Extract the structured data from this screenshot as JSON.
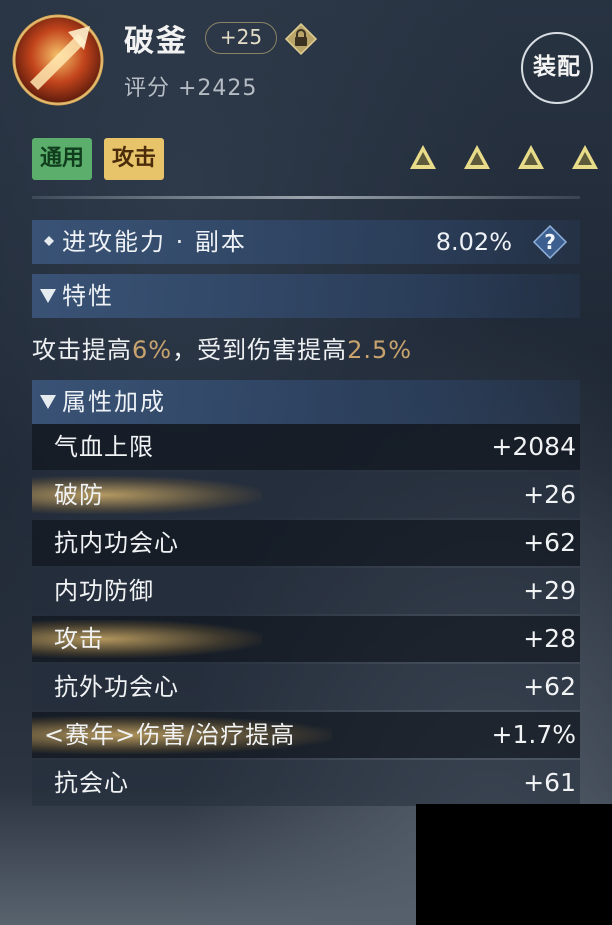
{
  "item": {
    "name": "破釜",
    "refine": "+25",
    "score": "评分 +2425",
    "equip_button": "装配"
  },
  "tags": [
    "通用",
    "攻击"
  ],
  "rank_markers": 4,
  "colors": {
    "accent_gold": "#c9a36e",
    "tag_green": "#5cae6d",
    "tag_orange": "#e7c36a"
  },
  "attack_stat": {
    "label": "进攻能力 · 副本",
    "value": "8.02%"
  },
  "traits": {
    "header": "特性",
    "text_a": "攻击提高",
    "val_a": "6%",
    "text_b": "，受到伤害提高",
    "val_b": "2.5%"
  },
  "attributes": {
    "header": "属性加成",
    "rows": [
      {
        "name": "气血上限",
        "value": "+2084"
      },
      {
        "name": "破防",
        "value": "+26"
      },
      {
        "name": "抗内功会心",
        "value": "+62"
      },
      {
        "name": "内功防御",
        "value": "+29"
      },
      {
        "name": "攻击",
        "value": "+28"
      },
      {
        "name": "抗外功会心",
        "value": "+62"
      },
      {
        "name": "<赛年>伤害/治疗提高",
        "value": "+1.7%"
      },
      {
        "name": "抗会心",
        "value": "+61"
      }
    ]
  }
}
